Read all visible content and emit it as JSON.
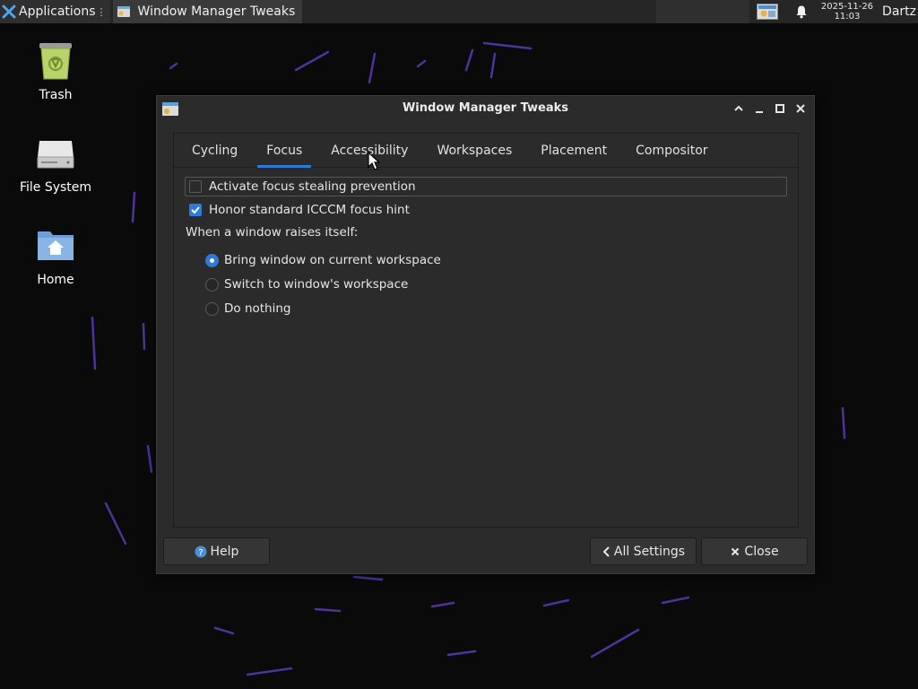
{
  "panel": {
    "applications_label": "Applications",
    "task_label": "Window Manager Tweaks",
    "clock_date": "2025-11-26",
    "clock_time": "11:03",
    "user": "Dartz"
  },
  "desktop": {
    "icons": [
      {
        "label": "Trash"
      },
      {
        "label": "File System"
      },
      {
        "label": "Home"
      }
    ]
  },
  "window": {
    "title": "Window Manager Tweaks",
    "tabs": [
      {
        "label": "Cycling"
      },
      {
        "label": "Focus",
        "active": true
      },
      {
        "label": "Accessibility"
      },
      {
        "label": "Workspaces"
      },
      {
        "label": "Placement"
      },
      {
        "label": "Compositor"
      }
    ],
    "focus": {
      "focus_stealing_label": "Activate focus stealing prevention",
      "focus_stealing_checked": false,
      "icccm_label": "Honor standard ICCCM focus hint",
      "icccm_checked": true,
      "raise_heading": "When a window raises itself:",
      "raise_options": [
        {
          "label": "Bring window on current workspace",
          "selected": true
        },
        {
          "label": "Switch to window's workspace",
          "selected": false
        },
        {
          "label": "Do nothing",
          "selected": false
        }
      ]
    },
    "buttons": {
      "help": "Help",
      "all_settings": "All Settings",
      "close": "Close"
    }
  },
  "colors": {
    "accent": "#2e7ad9",
    "window_bg": "#2b2b2b",
    "panel_bg": "#262626"
  }
}
